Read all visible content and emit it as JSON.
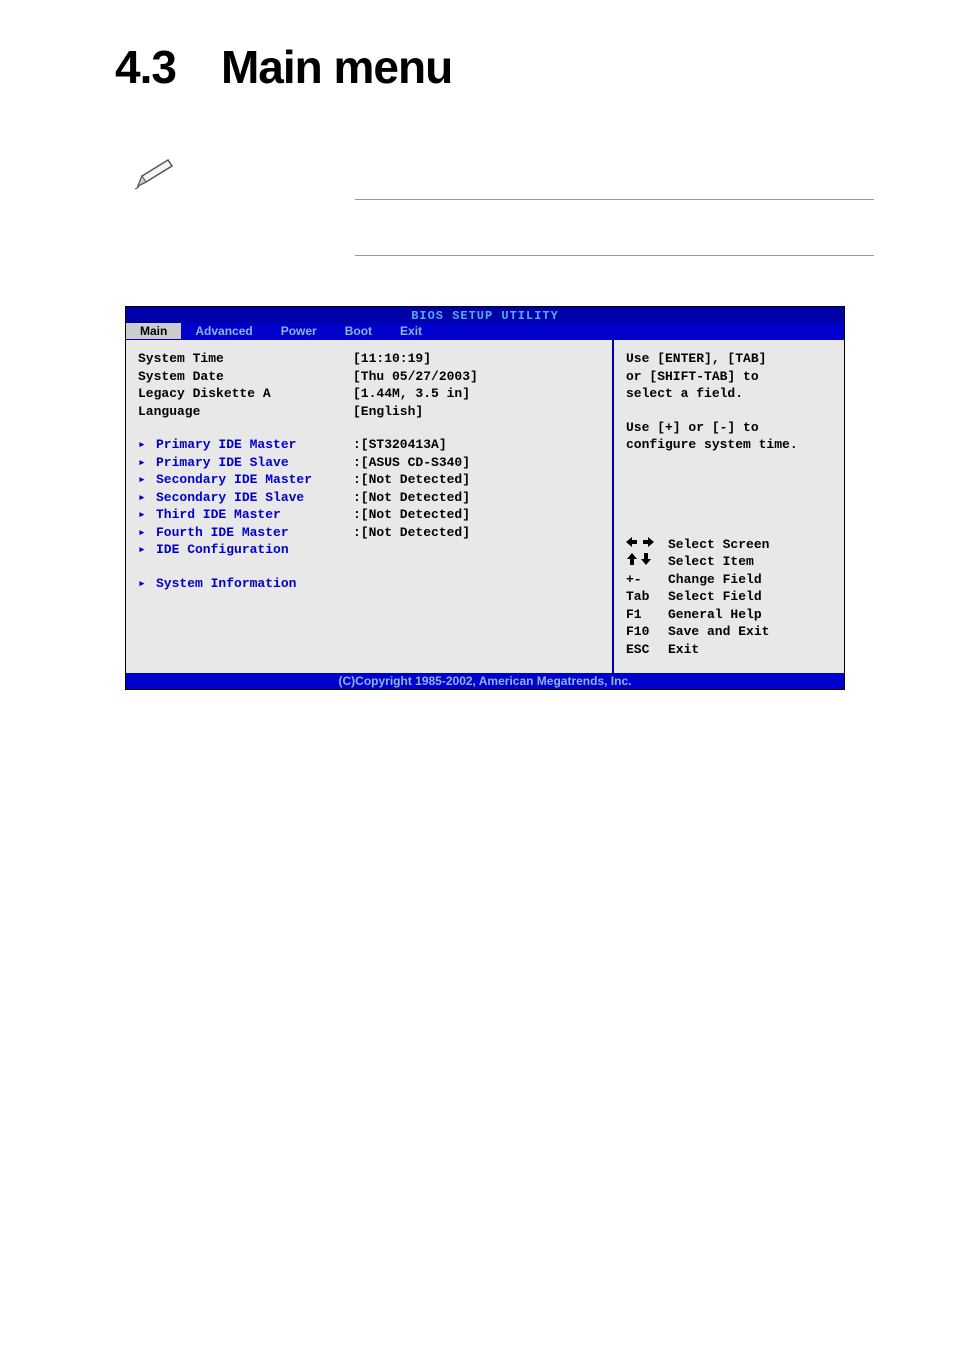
{
  "page": {
    "heading": "4.3 Main menu"
  },
  "bios": {
    "title": "BIOS SETUP UTILITY",
    "menu": {
      "main": "Main",
      "advanced": "Advanced",
      "power": "Power",
      "boot": "Boot",
      "exit": "Exit"
    },
    "fields": {
      "system_time": {
        "label": "System Time",
        "value": "[11:10:19]"
      },
      "system_date": {
        "label": "System Date",
        "value": "[Thu 05/27/2003]"
      },
      "legacy_diskette": {
        "label": "Legacy Diskette A",
        "value": "[1.44M, 3.5 in]"
      },
      "language": {
        "label": "Language",
        "value": "[English]"
      },
      "primary_ide_master": {
        "label": "Primary IDE Master",
        "value": ":[ST320413A]"
      },
      "primary_ide_slave": {
        "label": "Primary IDE Slave",
        "value": ":[ASUS CD-S340]"
      },
      "secondary_ide_master": {
        "label": "Secondary IDE Master",
        "value": ":[Not Detected]"
      },
      "secondary_ide_slave": {
        "label": "Secondary IDE Slave",
        "value": ":[Not Detected]"
      },
      "third_ide_master": {
        "label": "Third IDE Master",
        "value": ":[Not Detected]"
      },
      "fourth_ide_master": {
        "label": "Fourth IDE Master",
        "value": ":[Not Detected]"
      },
      "ide_configuration": {
        "label": "IDE Configuration"
      },
      "system_information": {
        "label": "System Information"
      }
    },
    "help": {
      "line1": "Use [ENTER], [TAB]",
      "line2": "or [SHIFT-TAB] to",
      "line3": "select a field.",
      "line4": "Use [+] or [-] to",
      "line5": "configure system time.",
      "nav": {
        "select_screen": "Select Screen",
        "select_item": "Select Item",
        "change_field_key": "+-",
        "change_field": "Change Field",
        "select_field_key": "Tab",
        "select_field": "Select Field",
        "general_help_key": "F1",
        "general_help": "General Help",
        "save_exit_key": "F10",
        "save_exit": "Save and Exit",
        "exit_key": "ESC",
        "exit": "Exit"
      }
    },
    "footer": "(C)Copyright 1985-2002, American Megatrends, Inc."
  }
}
